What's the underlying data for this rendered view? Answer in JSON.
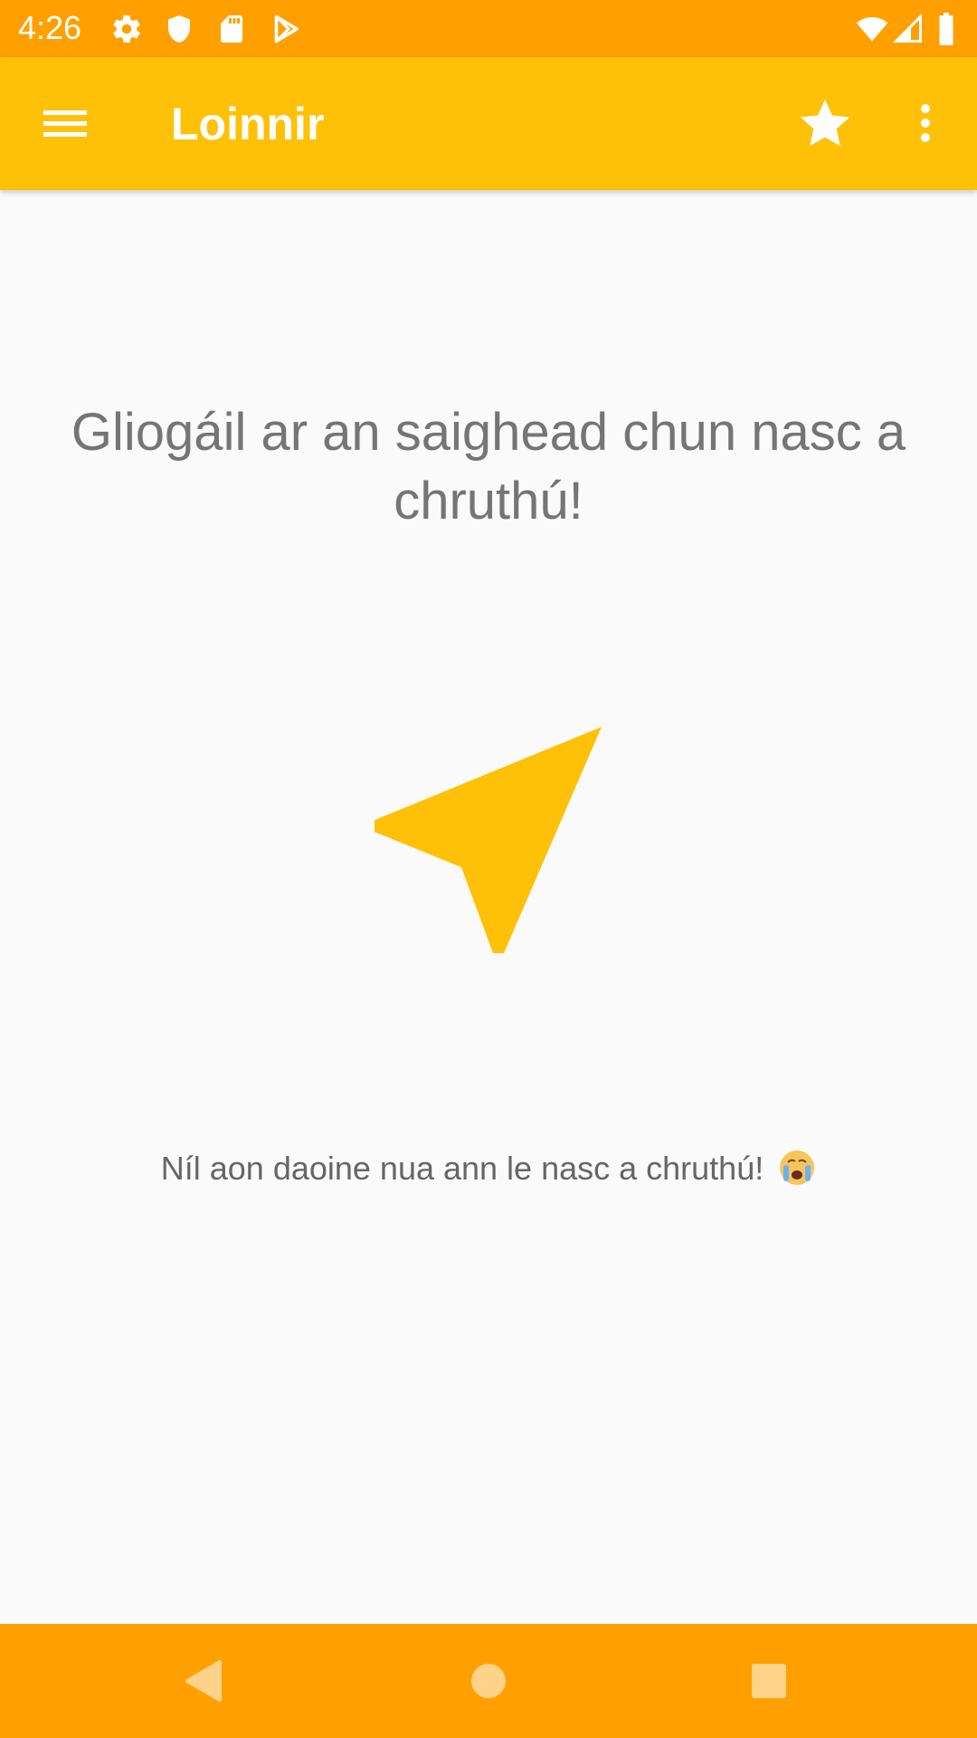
{
  "status_bar": {
    "time": "4:26",
    "left_icons": [
      "gear-icon",
      "shield-icon",
      "sd-card-icon",
      "play-store-icon"
    ],
    "right_icons": [
      "wifi-icon",
      "cell-signal-icon",
      "battery-icon"
    ]
  },
  "app_bar": {
    "title": "Loinnir",
    "menu_icon": "hamburger-menu-icon",
    "favorite_icon": "star-icon",
    "overflow_icon": "more-vertical-icon"
  },
  "main": {
    "headline": "Gliogáil ar an saighead chun nasc a chruthú!",
    "action_icon": "navigation-arrow-icon",
    "empty_message": "Níl aon daoine nua ann le nasc a chruthú!",
    "empty_emoji": "crying-face-icon"
  },
  "nav_bar": {
    "back_icon": "back-triangle-icon",
    "home_icon": "home-circle-icon",
    "recents_icon": "recents-square-icon"
  },
  "colors": {
    "status_bar": "#FFA000",
    "app_bar": "#FFC107",
    "accent": "#FFC107",
    "background": "#FAFAFA",
    "text_secondary": "#757575"
  }
}
